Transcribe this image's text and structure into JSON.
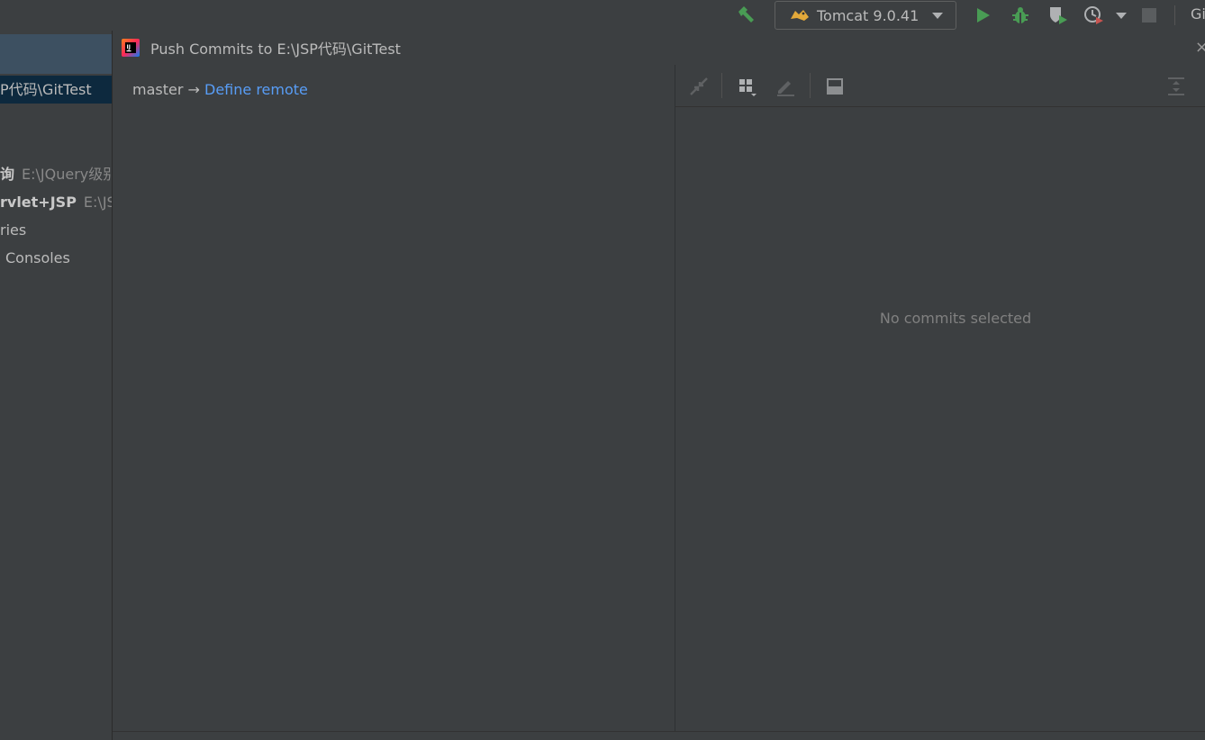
{
  "toolbar": {
    "build_icon": "hammer-icon",
    "run_config": {
      "label": "Tomcat 9.0.41",
      "icon": "tomcat-icon"
    },
    "run_icon": "play-icon",
    "debug_icon": "bug-icon",
    "coverage_icon": "coverage-icon",
    "profile_icon": "profiler-icon",
    "stop_icon": "stop-icon",
    "git_label": "Gi",
    "colors": {
      "green": "#499c54",
      "gray": "#5a5d5f"
    }
  },
  "project_panel": {
    "selected_path": "P代码\\GitTest",
    "rows": [
      {
        "name": "询",
        "path": "E:\\JQuery级别"
      },
      {
        "name": "rvlet+JSP",
        "path": "E:\\JS"
      },
      {
        "label": "ries"
      },
      {
        "label": "Consoles"
      }
    ]
  },
  "dialog": {
    "title": "Push Commits to E:\\JSP代码\\GitTest",
    "app_icon": "intellij-icon",
    "close_icon": "close-icon",
    "branch": "master",
    "arrow": "→",
    "define_remote": "Define remote",
    "right_toolbar": {
      "icons": [
        "collapse-icon",
        "group-by-icon",
        "edit-icon",
        "layout-icon",
        "expand-all-icon"
      ]
    },
    "empty_message": "No commits selected",
    "colors": {
      "link": "#589df6",
      "muted": "#808080"
    }
  }
}
